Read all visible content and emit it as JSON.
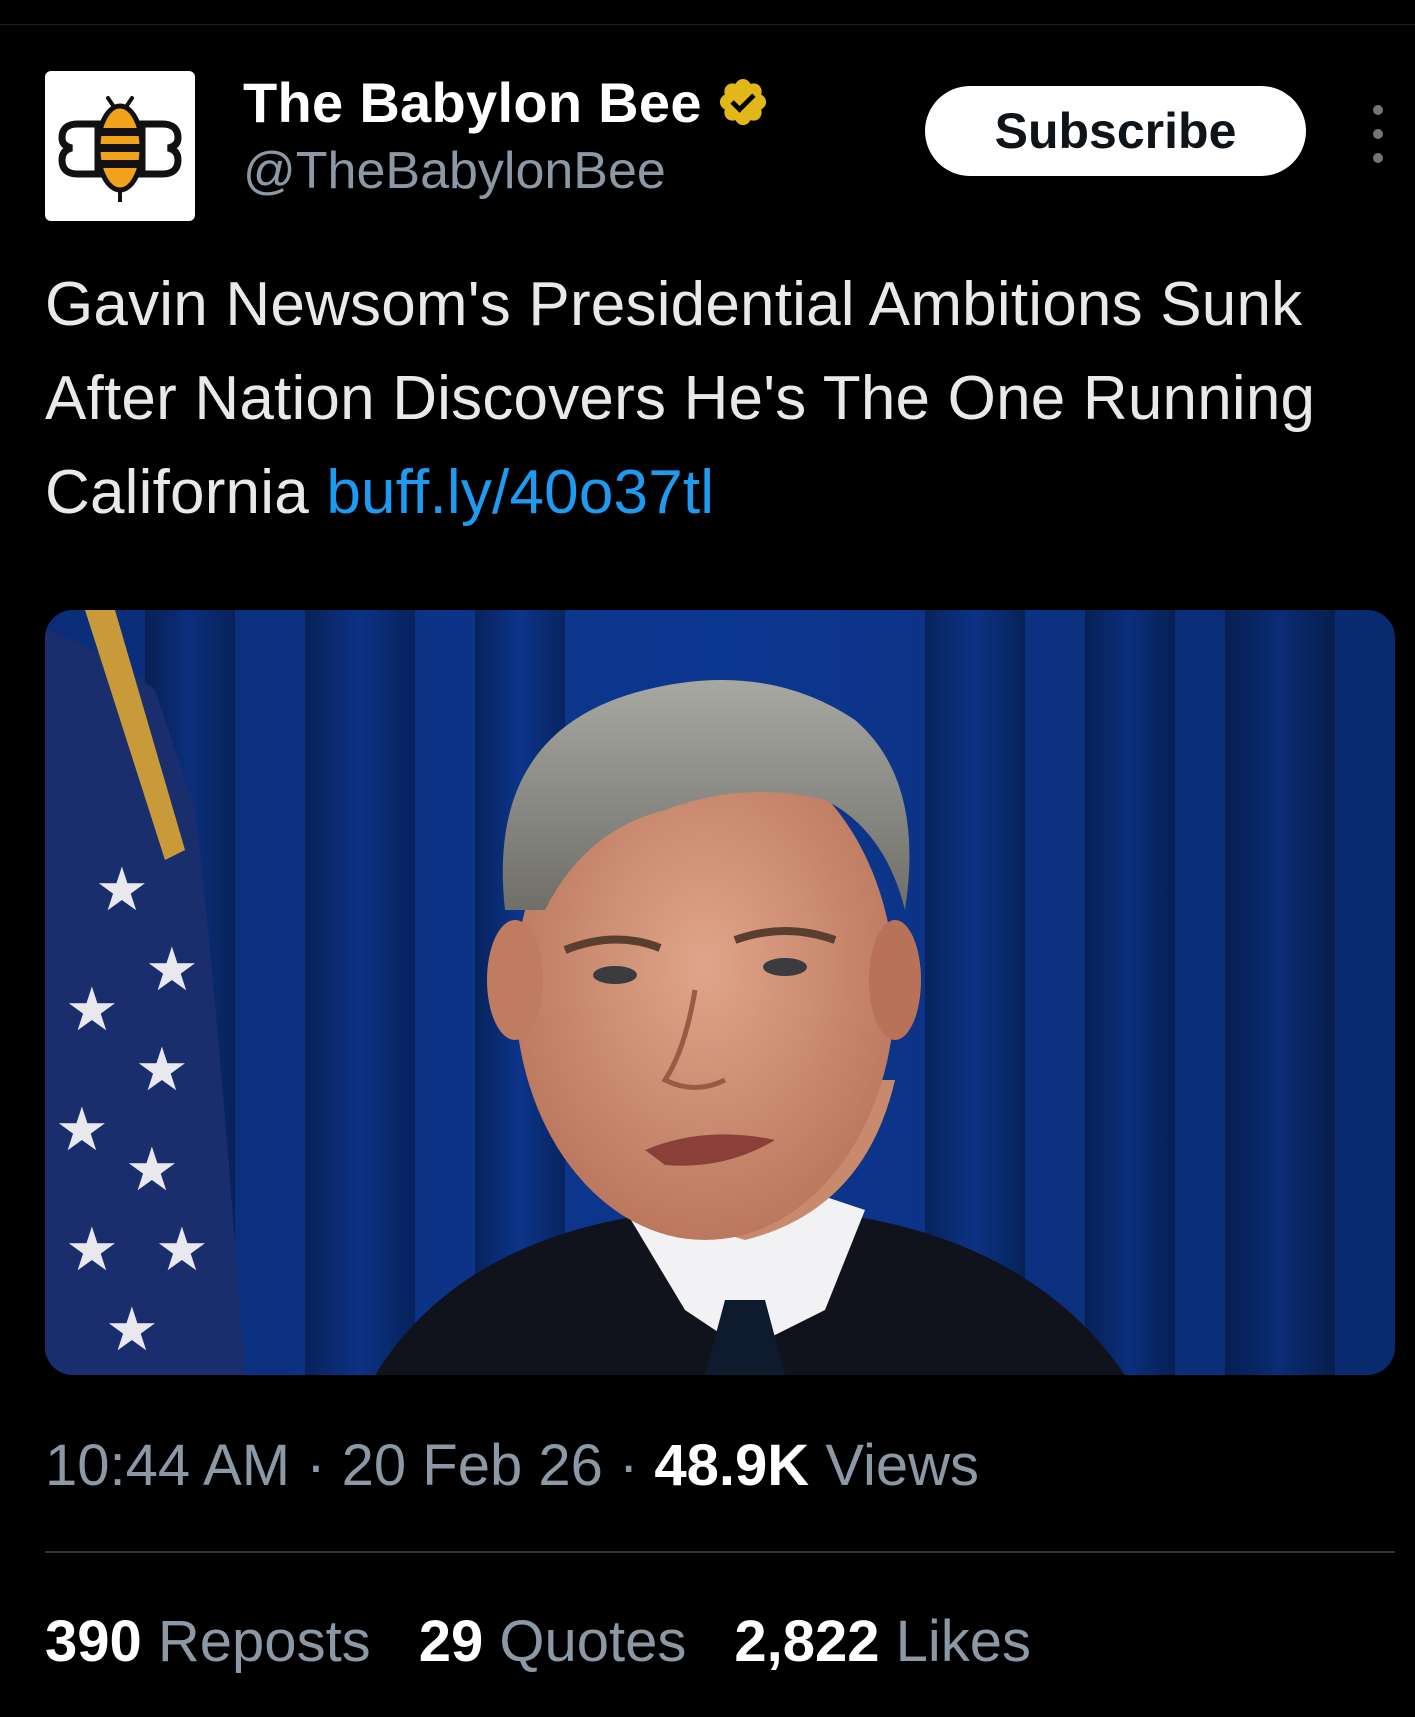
{
  "account": {
    "display_name": "The Babylon Bee",
    "handle": "@TheBabylonBee",
    "verified_icon": "gold-verified-badge",
    "avatar_icon": "babylon-bee-logo"
  },
  "header": {
    "subscribe_label": "Subscribe",
    "more_icon": "vertical-ellipsis"
  },
  "tweet": {
    "text": "Gavin Newsom's Presidential Ambitions Sunk After Nation Discovers He's The One Running California",
    "link": "buff.ly/40o37tl"
  },
  "media": {
    "description_icon": "photo-man-at-podium-blue-curtain-us-flag"
  },
  "meta": {
    "time": "10:44 AM",
    "sep1": "·",
    "date": "20 Feb 26",
    "sep2": "·",
    "views_count": "48.9K",
    "views_label": "Views"
  },
  "stats": {
    "reposts_count": "390",
    "reposts_label": "Reposts",
    "quotes_count": "29",
    "quotes_label": "Quotes",
    "likes_count": "2,822",
    "likes_label": "Likes"
  },
  "colors": {
    "background": "#000000",
    "link": "#1d9bf0",
    "muted": "#8b98a5",
    "verified_gold": "#e2b719"
  }
}
